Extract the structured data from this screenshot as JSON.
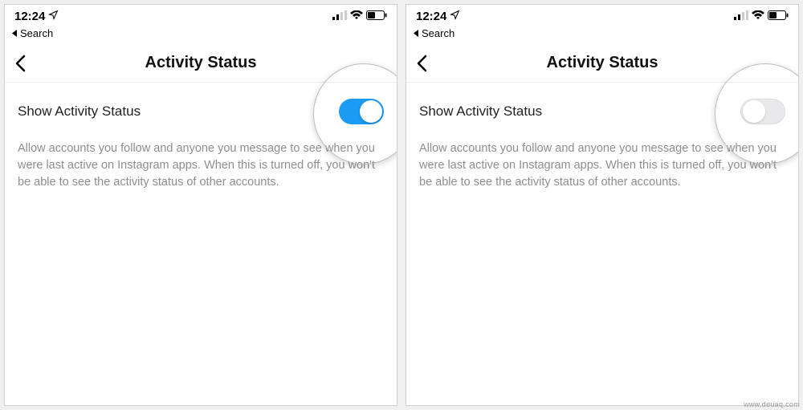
{
  "status": {
    "time": "12:24",
    "back_label": "Search"
  },
  "nav": {
    "title": "Activity Status"
  },
  "setting": {
    "label": "Show Activity Status",
    "description": "Allow accounts you follow and anyone you message to see when you were last active on Instagram apps. When this is turned off, you won't be able to see the activity status of other accounts."
  },
  "screens": [
    {
      "toggle_on": true
    },
    {
      "toggle_on": false
    }
  ],
  "watermark": "www.deuaq.com"
}
